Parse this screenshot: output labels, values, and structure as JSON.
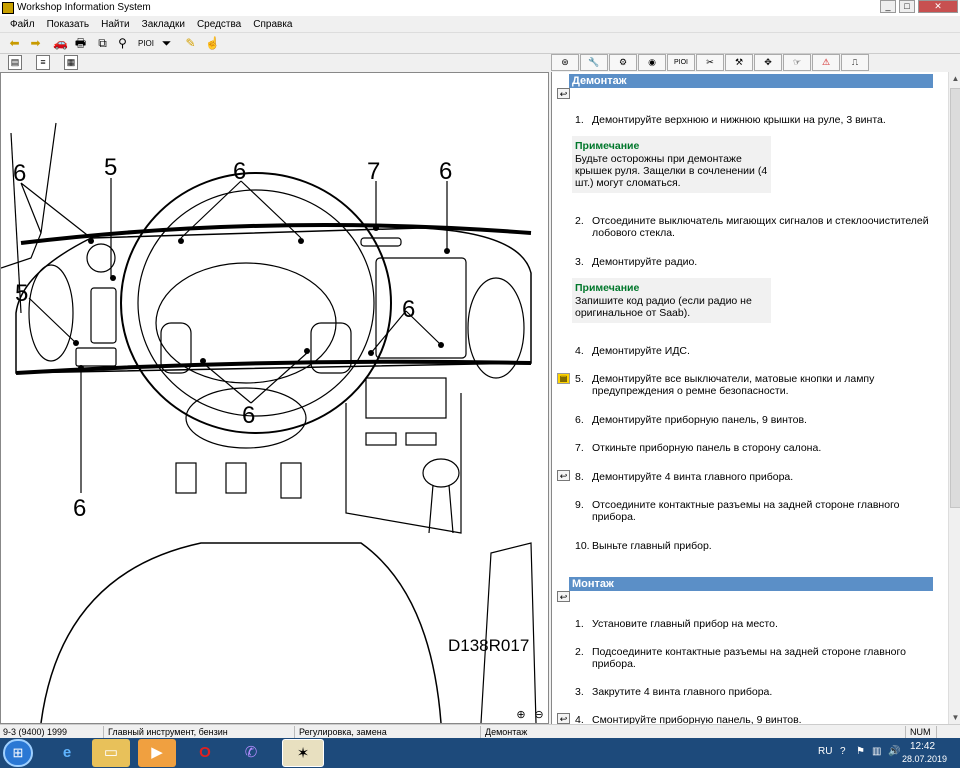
{
  "window": {
    "title": "Workshop Information System"
  },
  "menu": [
    "Файл",
    "Показать",
    "Найти",
    "Закладки",
    "Средства",
    "Справка"
  ],
  "toolbar": {
    "pioi_label": "PIOI"
  },
  "right_tabs": {
    "pioi_label": "PIOI"
  },
  "diagram": {
    "code": "D138R017",
    "callouts": [
      "6",
      "5",
      "6",
      "7",
      "6",
      "5",
      "6",
      "6",
      "6"
    ]
  },
  "sections": {
    "demontazh": {
      "title": "Демонтаж",
      "steps": [
        {
          "num": "1.",
          "text": "Демонтируйте верхнюю и нижнюю крышки на руле, 3 винта."
        },
        {
          "num": "2.",
          "text": "Отсоедините выключатель мигающих сигналов и стеклоочистителей лобового стекла."
        },
        {
          "num": "3.",
          "text": "Демонтируйте радио."
        },
        {
          "num": "4.",
          "text": "Демонтируйте ИДС."
        },
        {
          "num": "5.",
          "text": "Демонтируйте все выключатели, матовые кнопки и лампу предупреждения о ремне безопасности."
        },
        {
          "num": "6.",
          "text": "Демонтируйте приборную панель, 9 винтов."
        },
        {
          "num": "7.",
          "text": "Откиньте приборную панель в сторону салона."
        },
        {
          "num": "8.",
          "text": "Демонтируйте 4 винта главного прибора."
        },
        {
          "num": "9.",
          "text": "Отсоедините контактные разъемы на задней стороне главного прибора."
        },
        {
          "num": "10.",
          "text": "Выньте главный прибор."
        }
      ],
      "notes": [
        {
          "title": "Примечание",
          "text": "Будьте осторожны при демонтаже крышек руля. Защелки в сочленении (4 шт.) могут сломаться."
        },
        {
          "title": "Примечание",
          "text": "Запишите код радио (если радио не оригинальное от Saab)."
        }
      ]
    },
    "montazh": {
      "title": "Монтаж",
      "steps": [
        {
          "num": "1.",
          "text": "Установите главный прибор на место."
        },
        {
          "num": "2.",
          "text": "Подсоедините контактные разъемы на задней стороне главного прибора."
        },
        {
          "num": "3.",
          "text": "Закрутите 4 винта главного прибора."
        },
        {
          "num": "4.",
          "text": "Смонтируйте приборную панель, 9 винтов."
        }
      ]
    }
  },
  "status": {
    "model": "9-3 (9400) 1999",
    "component": "Главный инструмент, бензин",
    "category": "Регулировка, замена",
    "procedure": "Демонтаж",
    "num": "NUM"
  },
  "taskbar": {
    "lang": "RU",
    "time": "12:42",
    "date": "28.07.2019"
  },
  "colors": {
    "section_header": "#5b8fc7",
    "note_title": "#00772b",
    "taskbar": "#1d4a7b"
  }
}
